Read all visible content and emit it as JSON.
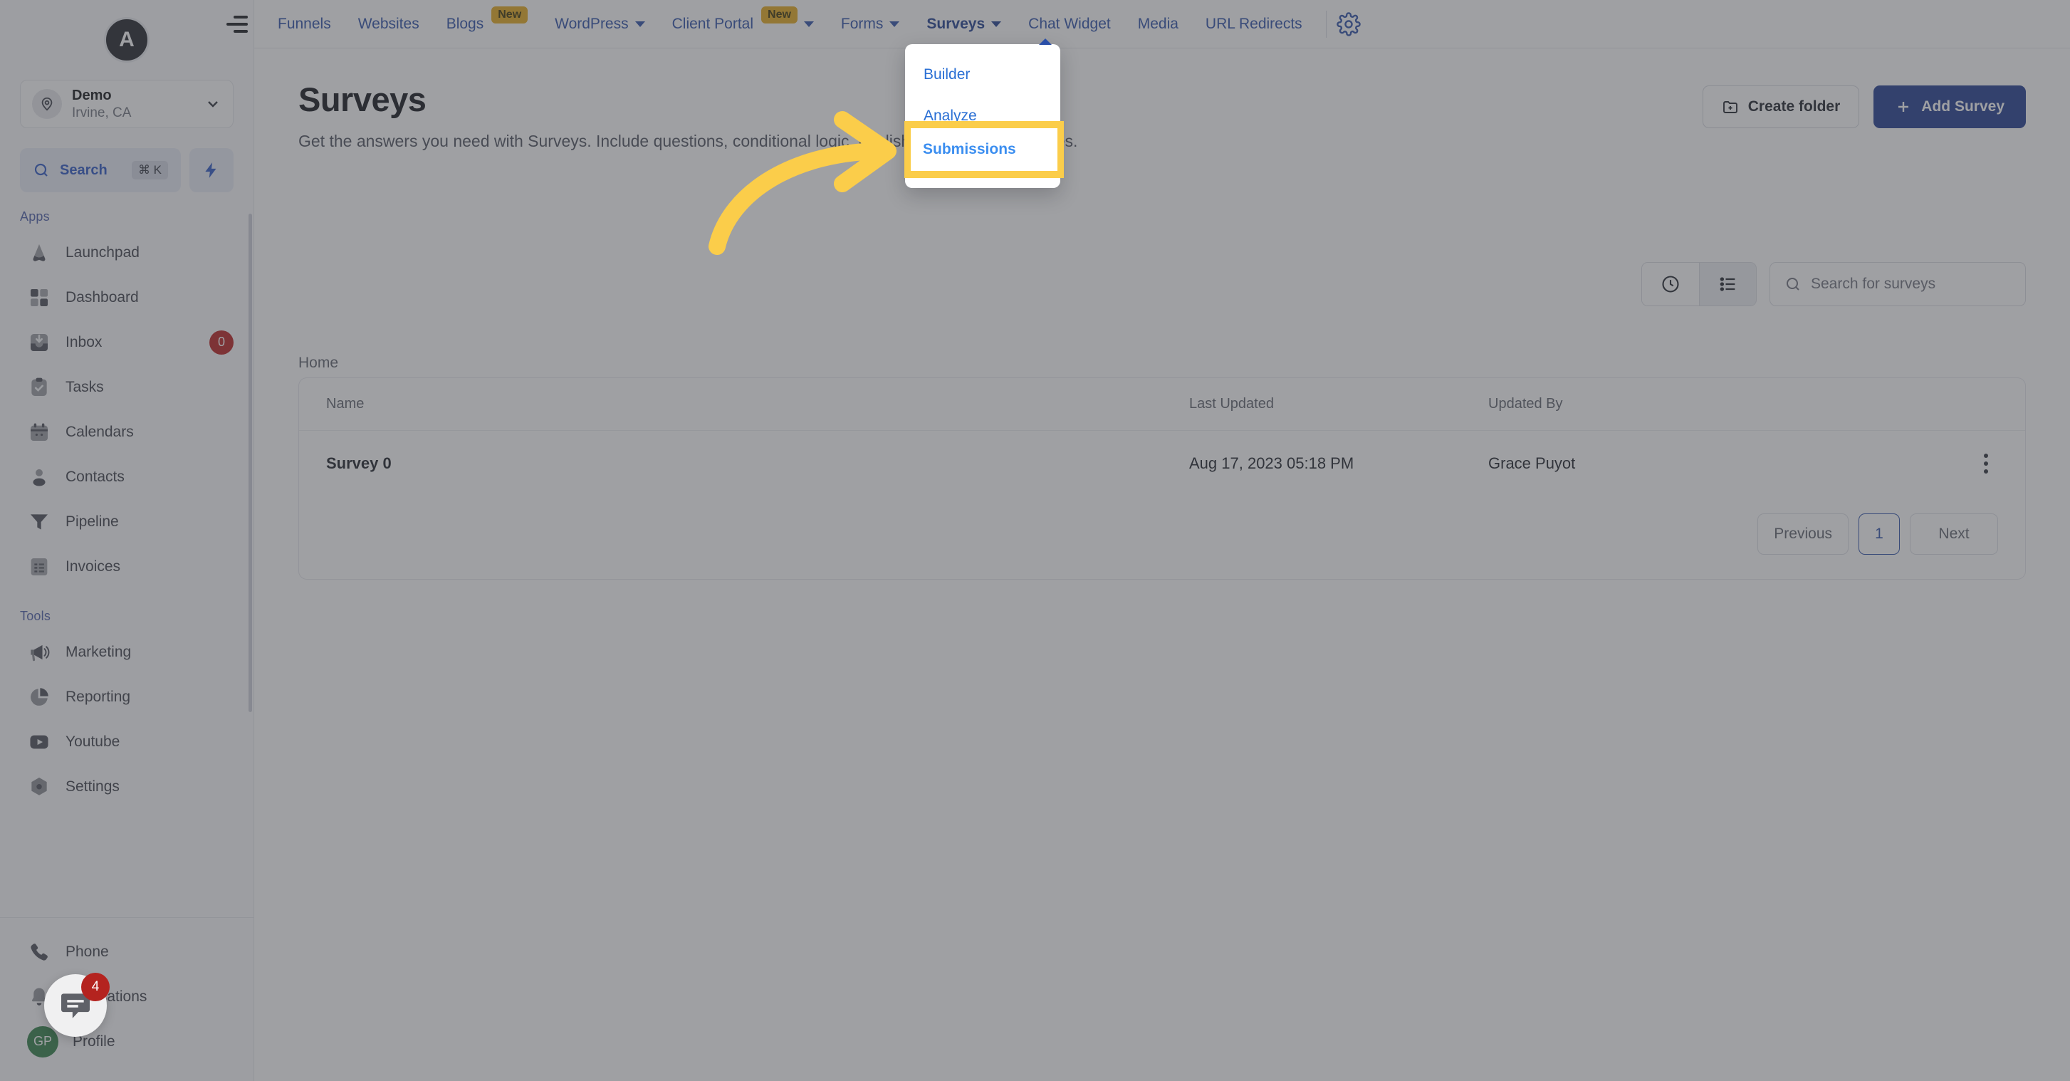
{
  "sidebar": {
    "brand_letter": "A",
    "workspace": {
      "name": "Demo",
      "location": "Irvine, CA"
    },
    "search": {
      "label": "Search",
      "shortcut": "⌘ K"
    },
    "apps_label": "Apps",
    "tools_label": "Tools",
    "apps": [
      {
        "label": "Launchpad",
        "icon": "launchpad-icon",
        "badge": ""
      },
      {
        "label": "Dashboard",
        "icon": "dashboard-icon",
        "badge": ""
      },
      {
        "label": "Inbox",
        "icon": "inbox-icon",
        "badge": "0"
      },
      {
        "label": "Tasks",
        "icon": "tasks-icon",
        "badge": ""
      },
      {
        "label": "Calendars",
        "icon": "calendar-icon",
        "badge": ""
      },
      {
        "label": "Contacts",
        "icon": "contacts-icon",
        "badge": ""
      },
      {
        "label": "Pipeline",
        "icon": "pipeline-icon",
        "badge": ""
      },
      {
        "label": "Invoices",
        "icon": "invoices-icon",
        "badge": ""
      }
    ],
    "tools": [
      {
        "label": "Marketing",
        "icon": "megaphone-icon",
        "badge": ""
      },
      {
        "label": "Reporting",
        "icon": "pie-chart-icon",
        "badge": ""
      },
      {
        "label": "Youtube",
        "icon": "youtube-icon",
        "badge": ""
      },
      {
        "label": "Settings",
        "icon": "settings-icon",
        "badge": ""
      }
    ],
    "footer": [
      {
        "label": "Phone",
        "icon": "phone-icon",
        "badge": ""
      },
      {
        "label": "Notifications",
        "icon": "bell-icon",
        "badge": ""
      },
      {
        "label": "Profile",
        "icon": "avatar-icon",
        "badge": ""
      }
    ],
    "profile_initials": "GP"
  },
  "topnav": {
    "items": [
      {
        "label": "Funnels",
        "badge": "",
        "caret": false,
        "active": false
      },
      {
        "label": "Websites",
        "badge": "",
        "caret": false,
        "active": false
      },
      {
        "label": "Blogs",
        "badge": "New",
        "caret": false,
        "active": false
      },
      {
        "label": "WordPress",
        "badge": "",
        "caret": true,
        "active": false
      },
      {
        "label": "Client Portal",
        "badge": "New",
        "caret": true,
        "active": false
      },
      {
        "label": "Forms",
        "badge": "",
        "caret": true,
        "active": false
      },
      {
        "label": "Surveys",
        "badge": "",
        "caret": true,
        "active": true
      },
      {
        "label": "Chat Widget",
        "badge": "",
        "caret": false,
        "active": false
      },
      {
        "label": "Media",
        "badge": "",
        "caret": false,
        "active": false
      },
      {
        "label": "URL Redirects",
        "badge": "",
        "caret": false,
        "active": false
      }
    ],
    "settings_icon": "gear-icon"
  },
  "dropdown": {
    "items": [
      {
        "label": "Builder",
        "highlighted": false
      },
      {
        "label": "Analyze",
        "highlighted": false
      },
      {
        "label": "Submissions",
        "highlighted": true
      }
    ]
  },
  "annotation": {
    "highlight_label": "Submissions",
    "highlight_color": "#fbcd4a",
    "arrow_color": "#fbcd4a"
  },
  "main": {
    "title": "Surveys",
    "subtitle": "Get the answers you need with Surveys. Include questions, conditional logic, publish and collect responses.",
    "create_folder_label": "Create folder",
    "add_survey_label": "Add Survey",
    "breadcrumb": "Home",
    "search_placeholder": "Search for surveys",
    "view_recent_icon": "clock-icon",
    "view_list_icon": "list-icon",
    "table": {
      "columns": [
        "Name",
        "Last Updated",
        "Updated By"
      ],
      "rows": [
        {
          "name": "Survey 0",
          "last_updated": "Aug 17, 2023 05:18 PM",
          "updated_by": "Grace Puyot"
        }
      ]
    },
    "pagination": {
      "previous": "Previous",
      "page": "1",
      "next": "Next"
    }
  },
  "chat_widget": {
    "badge": "4",
    "icon": "chat-bubble-icon"
  },
  "colors": {
    "accent": "#2a4fa8",
    "primary_button": "#1e3a8f",
    "badge_new": "#e6a919",
    "badge_alert": "#b91c1c"
  }
}
